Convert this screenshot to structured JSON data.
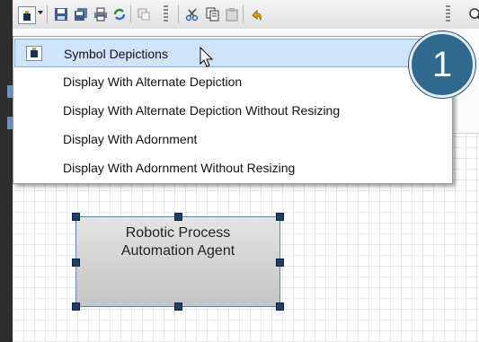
{
  "toolbar": {
    "buttons": [
      {
        "name": "depiction-icon",
        "interactable": true
      },
      {
        "name": "save-icon",
        "interactable": true
      },
      {
        "name": "save-all-icon",
        "interactable": true
      },
      {
        "name": "print-icon",
        "interactable": true
      },
      {
        "name": "refresh-icon",
        "interactable": true
      },
      {
        "name": "properties-icon",
        "interactable": true
      },
      {
        "name": "cut-icon",
        "interactable": true
      },
      {
        "name": "copy-icon",
        "interactable": true
      },
      {
        "name": "paste-icon",
        "interactable": true
      },
      {
        "name": "undo-icon",
        "interactable": true
      },
      {
        "name": "zoom-icon",
        "interactable": true
      }
    ]
  },
  "menu": {
    "items": [
      {
        "label": "Symbol Depictions",
        "selected": true
      },
      {
        "label": "Display With Alternate Depiction",
        "selected": false
      },
      {
        "label": "Display With Alternate Depiction Without Resizing",
        "selected": false
      },
      {
        "label": "Display With Adornment",
        "selected": false
      },
      {
        "label": "Display With Adornment Without Resizing",
        "selected": false
      }
    ]
  },
  "badge": {
    "text": "1"
  },
  "shape": {
    "line1": "Robotic Process",
    "line2": "Automation Agent"
  },
  "colors": {
    "selection": "#cfe3fa",
    "badge": "#2f6a8e",
    "shape_border": "#5a86b6"
  }
}
